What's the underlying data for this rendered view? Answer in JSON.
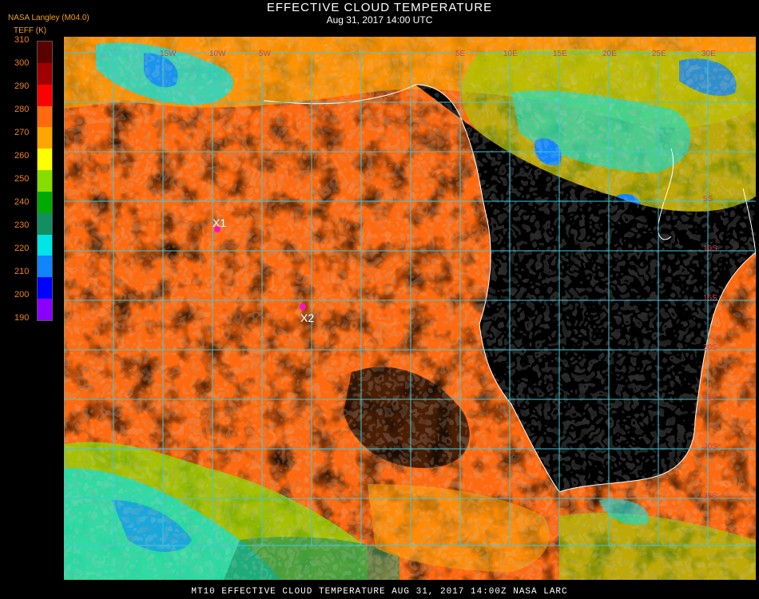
{
  "header": {
    "title": "EFFECTIVE CLOUD TEMPERATURE",
    "date": "Aug 31, 2017 14:00 UTC"
  },
  "source_label": "NASA Langley (M04.0)",
  "unit_label": "TEFF (K)",
  "color_scale": {
    "labels": [
      "310",
      "300",
      "290",
      "280",
      "270",
      "260",
      "250",
      "240",
      "230",
      "220",
      "210",
      "200",
      "190"
    ],
    "colors": [
      "#5a0000",
      "#a00000",
      "#ff0000",
      "#ff6a10",
      "#ffa500",
      "#ffff00",
      "#88dd00",
      "#00aa00",
      "#138e60",
      "#00e5e5",
      "#0f85ff",
      "#0000ff",
      "#8a00ff"
    ]
  },
  "markers": [
    {
      "label": "X1",
      "color": "#ff10c0"
    },
    {
      "label": "X2",
      "color": "#ff10c0"
    }
  ],
  "grid_labels": {
    "longitudes": [
      "15W",
      "10W",
      "5W",
      "5E",
      "10E",
      "15E",
      "20E",
      "25E",
      "30E"
    ],
    "latitudes": [
      "5S",
      "10S",
      "15S",
      "20S",
      "25S",
      "30S",
      "35S"
    ]
  },
  "footer": "MT10  EFFECTIVE CLOUD TEMPERATURE  AUG 31, 2017 14:00Z  NASA LARC",
  "colors": {
    "grid": "#40c8d8",
    "coast": "#ffffff",
    "background": "#000000"
  }
}
